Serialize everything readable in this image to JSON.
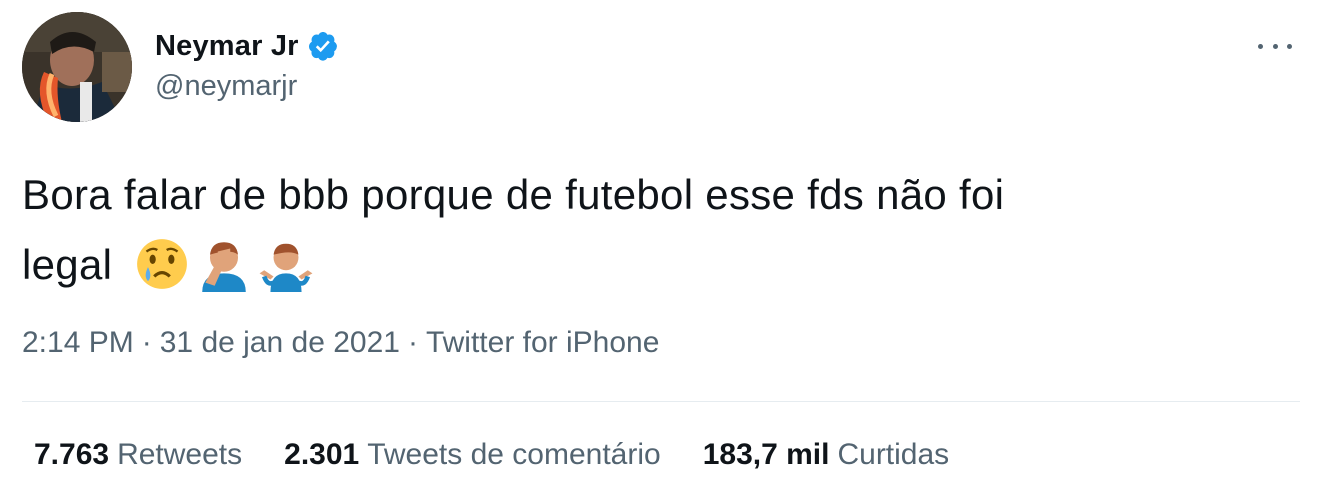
{
  "author": {
    "display_name": "Neymar Jr",
    "handle": "@neymarjr",
    "verified": true
  },
  "tweet": {
    "text_line1": "Bora falar de bbb porque de futebol esse fds não foi",
    "text_line2": "legal",
    "emojis": [
      "crying-face-emoji",
      "man-facepalming-emoji",
      "man-shrugging-emoji"
    ]
  },
  "meta": {
    "time": "2:14 PM",
    "separator": "·",
    "date": "31 de jan de 2021",
    "source": "Twitter for iPhone"
  },
  "stats": {
    "retweets_count": "7.763",
    "retweets_label": "Retweets",
    "quotes_count": "2.301",
    "quotes_label": "Tweets de comentário",
    "likes_count": "183,7 mil",
    "likes_label": "Curtidas"
  },
  "colors": {
    "text_primary": "#0f1419",
    "text_secondary": "#536471",
    "verified_blue": "#1d9bf0",
    "divider": "#e6ecf0"
  }
}
